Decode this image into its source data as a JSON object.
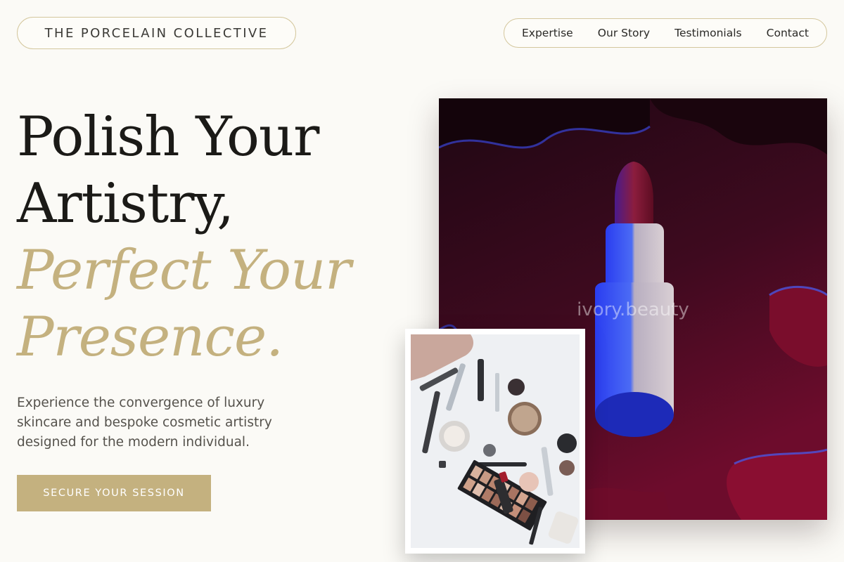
{
  "header": {
    "brand": "THE PORCELAIN COLLECTIVE",
    "nav": [
      {
        "label": "Expertise"
      },
      {
        "label": "Our Story"
      },
      {
        "label": "Testimonials"
      },
      {
        "label": "Contact"
      }
    ]
  },
  "hero": {
    "title_line1": "Polish Your",
    "title_line2": "Artistry,",
    "title_line3": "Perfect Your",
    "title_line4": "Presence.",
    "description": "Experience the convergence of luxury skincare and bespoke cosmetic artistry designed for the modern individual.",
    "cta_label": "SECURE YOUR SESSION"
  },
  "images": {
    "main_watermark": "ivory.beauty"
  },
  "colors": {
    "background": "#fbfaf6",
    "accent_gold": "#c4b17f",
    "text_dark": "#1b1a17",
    "border": "#d4c79d"
  }
}
